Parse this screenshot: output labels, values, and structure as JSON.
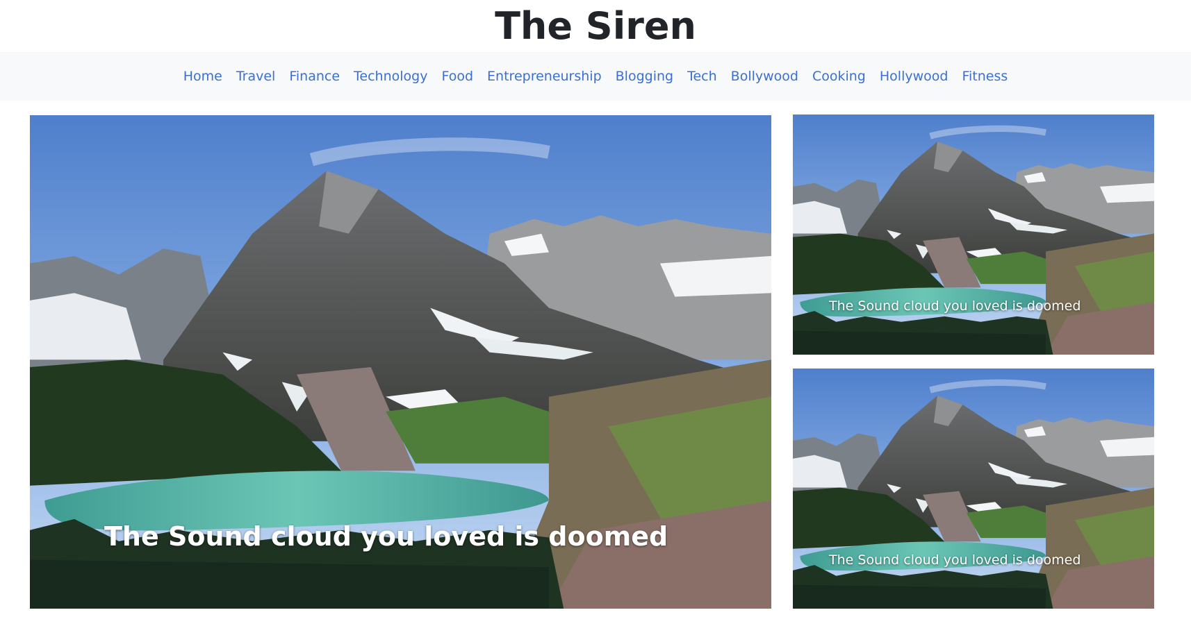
{
  "site": {
    "title": "The Siren"
  },
  "nav": {
    "items": [
      {
        "label": "Home"
      },
      {
        "label": "Travel"
      },
      {
        "label": "Finance"
      },
      {
        "label": "Technology"
      },
      {
        "label": "Food"
      },
      {
        "label": "Entrepreneurship"
      },
      {
        "label": "Blogging"
      },
      {
        "label": "Tech"
      },
      {
        "label": "Bollywood"
      },
      {
        "label": "Cooking"
      },
      {
        "label": "Hollywood"
      },
      {
        "label": "Fitness"
      }
    ]
  },
  "featured": {
    "main": {
      "caption": "The Sound cloud you loved is doomed",
      "image": "mountain-lake-photo"
    },
    "side": [
      {
        "caption": "The Sound cloud you loved is doomed",
        "image": "mountain-lake-photo"
      },
      {
        "caption": "The Sound cloud you loved is doomed",
        "image": "mountain-lake-photo"
      }
    ]
  },
  "colors": {
    "nav_bg": "#f8f9fa",
    "link": "#3b6fd1",
    "title": "#212529"
  }
}
